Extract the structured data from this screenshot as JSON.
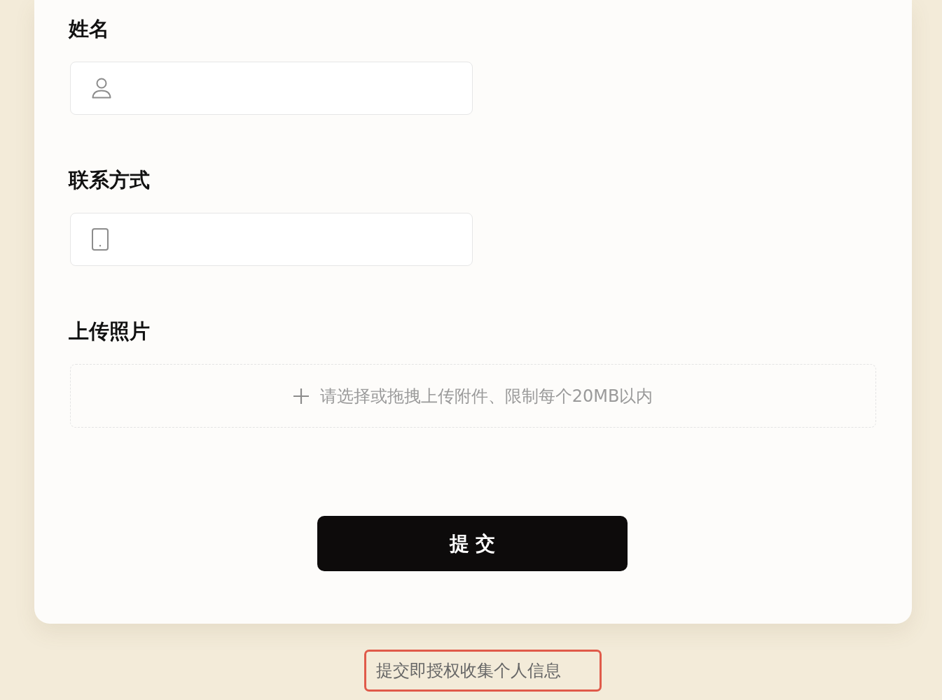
{
  "form": {
    "fields": [
      {
        "kind": "name",
        "label": "姓名"
      },
      {
        "kind": "phone",
        "label": "联系方式"
      },
      {
        "kind": "upload",
        "label": "上传照片",
        "hint": "请选择或拖拽上传附件、限制每个20MB以内"
      }
    ],
    "submit_button": {
      "label": "提 交"
    }
  },
  "consent_note": {
    "text": "提交即授权收集个人信息",
    "highlighted": true
  }
}
